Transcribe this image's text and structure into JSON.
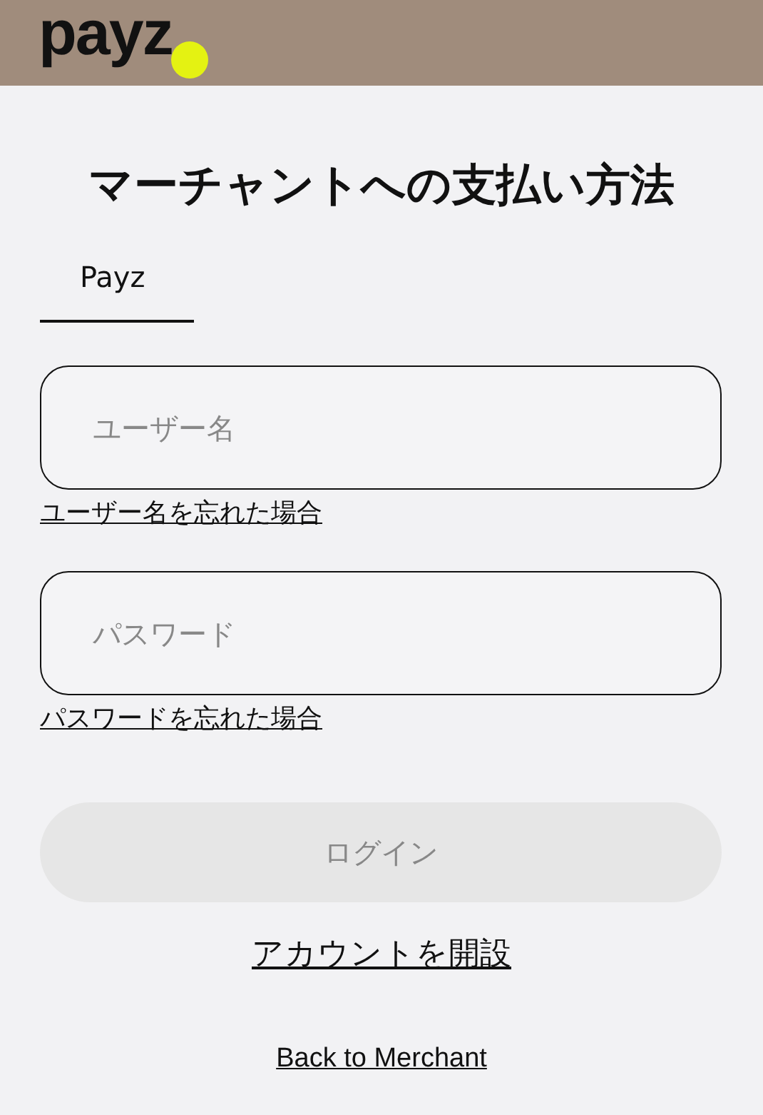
{
  "header": {
    "logo": "payz"
  },
  "title": "マーチャントへの支払い方法",
  "tabs": [
    {
      "label": "Payz",
      "selected": true
    }
  ],
  "fields": [
    {
      "placeholder": "ユーザー名",
      "link": "ユーザー名を忘れた場合"
    },
    {
      "placeholder": "パスワード",
      "link": "パスワードを忘れた場合"
    }
  ],
  "login_button": {
    "label": "ログイン",
    "disabled": true
  },
  "open_account_link": "アカウントを開設",
  "back_link": "Back to Merchant"
}
